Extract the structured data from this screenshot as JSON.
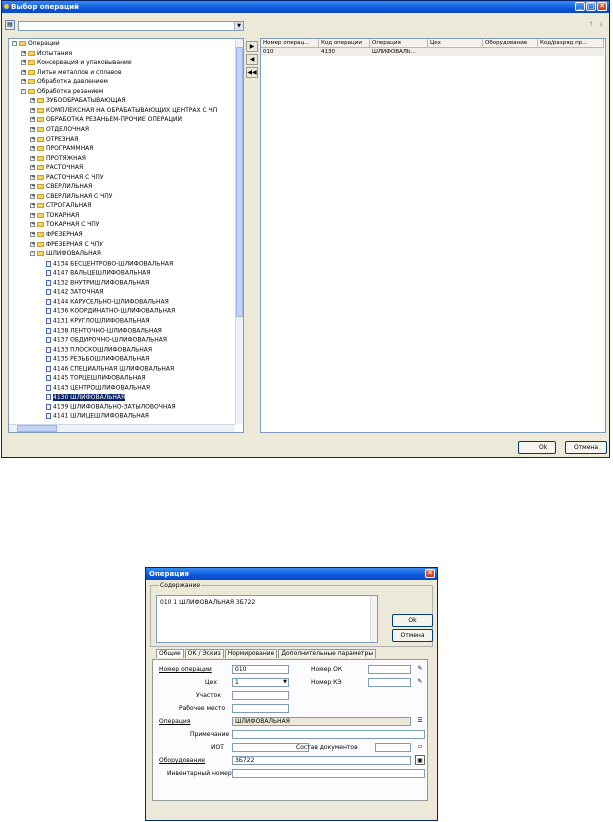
{
  "window1": {
    "title": "Выбор операций",
    "controls": {
      "minimize": "_",
      "maximize": "□",
      "close": "✕"
    },
    "tree_items": [
      {
        "label": "Операции",
        "type": "folder",
        "level": 0,
        "expand": "-"
      },
      {
        "label": "Испытания",
        "type": "folder",
        "level": 1,
        "expand": "+"
      },
      {
        "label": "Консервация и упаковывание",
        "type": "folder",
        "level": 1,
        "expand": "+"
      },
      {
        "label": "Литье металлов и сплавов",
        "type": "folder",
        "level": 1,
        "expand": "+"
      },
      {
        "label": "Обработка давлением",
        "type": "folder",
        "level": 1,
        "expand": "+"
      },
      {
        "label": "Обработка резанием",
        "type": "folder",
        "level": 1,
        "expand": "-"
      },
      {
        "label": "ЗУБООБРАБАТЫВАЮЩАЯ",
        "type": "folder",
        "level": 2,
        "expand": "+"
      },
      {
        "label": "КОМПЛЕКСНАЯ НА ОБРАБАТЫВАЮЩИХ ЦЕНТРАХ С ЧП",
        "type": "folder",
        "level": 2,
        "expand": "+"
      },
      {
        "label": "ОБРАБОТКА РЕЗАНЬЕМ-ПРОЧИЕ ОПЕРАЦИИ",
        "type": "folder",
        "level": 2,
        "expand": "+"
      },
      {
        "label": "ОТДЕЛОЧНАЯ",
        "type": "folder",
        "level": 2,
        "expand": "+"
      },
      {
        "label": "ОТРЕЗНАЯ",
        "type": "folder",
        "level": 2,
        "expand": "+"
      },
      {
        "label": "ПРОГРАММНАЯ",
        "type": "folder",
        "level": 2,
        "expand": "+"
      },
      {
        "label": "ПРОТЯЖНАЯ",
        "type": "folder",
        "level": 2,
        "expand": "+"
      },
      {
        "label": "РАСТОЧНАЯ",
        "type": "folder",
        "level": 2,
        "expand": "+"
      },
      {
        "label": "РАСТОЧНАЯ С ЧПУ",
        "type": "folder",
        "level": 2,
        "expand": "+"
      },
      {
        "label": "СВЕРЛИЛЬНАЯ",
        "type": "folder",
        "level": 2,
        "expand": "+"
      },
      {
        "label": "СВЕРЛИЛЬНАЯ С ЧПУ",
        "type": "folder",
        "level": 2,
        "expand": "+"
      },
      {
        "label": "СТРОГАЛЬНАЯ",
        "type": "folder",
        "level": 2,
        "expand": "+"
      },
      {
        "label": "ТОКАРНАЯ",
        "type": "folder",
        "level": 2,
        "expand": "+"
      },
      {
        "label": "ТОКАРНАЯ С ЧПУ",
        "type": "folder",
        "level": 2,
        "expand": "+"
      },
      {
        "label": "ФРЕЗЕРНАЯ",
        "type": "folder",
        "level": 2,
        "expand": "+"
      },
      {
        "label": "ФРЕЗЕРНАЯ С ЧПУ",
        "type": "folder",
        "level": 2,
        "expand": "+"
      },
      {
        "label": "ШЛИФОВАЛЬНАЯ",
        "type": "folder",
        "level": 2,
        "expand": "-"
      },
      {
        "label": "4134 БЕСЦЕНТРОВО-ШЛИФОВАЛЬНАЯ",
        "type": "doc",
        "level": 3
      },
      {
        "label": "4147 ВАЛЬЦЕШЛИФОВАЛЬНАЯ",
        "type": "doc",
        "level": 3
      },
      {
        "label": "4132 ВНУТРИШЛИФОВАЛЬНАЯ",
        "type": "doc",
        "level": 3
      },
      {
        "label": "4142 ЗАТОЧНАЯ",
        "type": "doc",
        "level": 3
      },
      {
        "label": "4144 КАРУСЕЛЬНО-ШЛИФОВАЛЬНАЯ",
        "type": "doc",
        "level": 3
      },
      {
        "label": "4136 КООРДИНАТНО-ШЛИФОВАЛЬНАЯ",
        "type": "doc",
        "level": 3
      },
      {
        "label": "4131 КРУГЛОШЛИФОВАЛЬНАЯ",
        "type": "doc",
        "level": 3
      },
      {
        "label": "4138 ЛЕНТОЧНО-ШЛИФОВАЛЬНАЯ",
        "type": "doc",
        "level": 3
      },
      {
        "label": "4137 ОБДИРОЧНО-ШЛИФОВАЛЬНАЯ",
        "type": "doc",
        "level": 3
      },
      {
        "label": "4133 ПЛОСКОШЛИФОВАЛЬНАЯ",
        "type": "doc",
        "level": 3
      },
      {
        "label": "4135 РЕЗЬБОШЛИФОВАЛЬНАЯ",
        "type": "doc",
        "level": 3
      },
      {
        "label": "4146 СПЕЦИАЛЬНАЯ ШЛИФОВАЛЬНАЯ",
        "type": "doc",
        "level": 3
      },
      {
        "label": "4145 ТОРЦЕШЛИФОВАЛЬНАЯ",
        "type": "doc",
        "level": 3
      },
      {
        "label": "4143 ЦЕНТРОШЛИФОВАЛЬНАЯ",
        "type": "doc",
        "level": 3
      },
      {
        "label": "4130 ШЛИФОВАЛЬНАЯ",
        "type": "doc",
        "level": 3,
        "selected": true
      },
      {
        "label": "4139 ШЛИФОВАЛЬНО-ЗАТЫЛОВОЧНАЯ",
        "type": "doc",
        "level": 3
      },
      {
        "label": "4141 ШЛИЦЕШЛИФОВАЛЬНАЯ",
        "type": "doc",
        "level": 3
      }
    ],
    "grid_columns": [
      "Номер операц...",
      "Код операции",
      "Операция",
      "Цех",
      "Оборудование",
      "Код/разряд пр..."
    ],
    "grid_rows": [
      [
        "010",
        "4130",
        "ШЛИФОВАЛЬ...",
        "",
        "",
        ""
      ]
    ],
    "move_buttons": {
      "add": "▶",
      "remove": "◀",
      "remove_all": "◀◀"
    },
    "ok_label": "Ok",
    "cancel_label": "Отмена"
  },
  "window2": {
    "title": "Операция",
    "content_group_label": "Содержание",
    "content_text": "010 1 ШЛИФОВАЛЬНАЯ 3Б722",
    "ok_label": "Ok",
    "cancel_label": "Отмена",
    "tabs": [
      "Общие",
      "ОК / Эскиз",
      "Нормирование",
      "Дополнительные параметры"
    ],
    "fields": {
      "op_number_label": "Номер операции",
      "op_number_value": "010",
      "workshop_label": "Цех",
      "workshop_value": "1",
      "section_label": "Участок",
      "workplace_label": "Рабочее место",
      "operation_label": "Операция",
      "operation_value": "ШЛИФОВАЛЬНАЯ",
      "note_label": "Примечание",
      "iot_label": "ИОТ",
      "docs_label": "Состав документов",
      "equipment_label": "Оборудование",
      "equipment_value": "3Б722",
      "inventory_label": "Инвентарный номер",
      "ok_number_label": "Номер ОК",
      "ke_number_label": "Номер КЭ"
    }
  }
}
